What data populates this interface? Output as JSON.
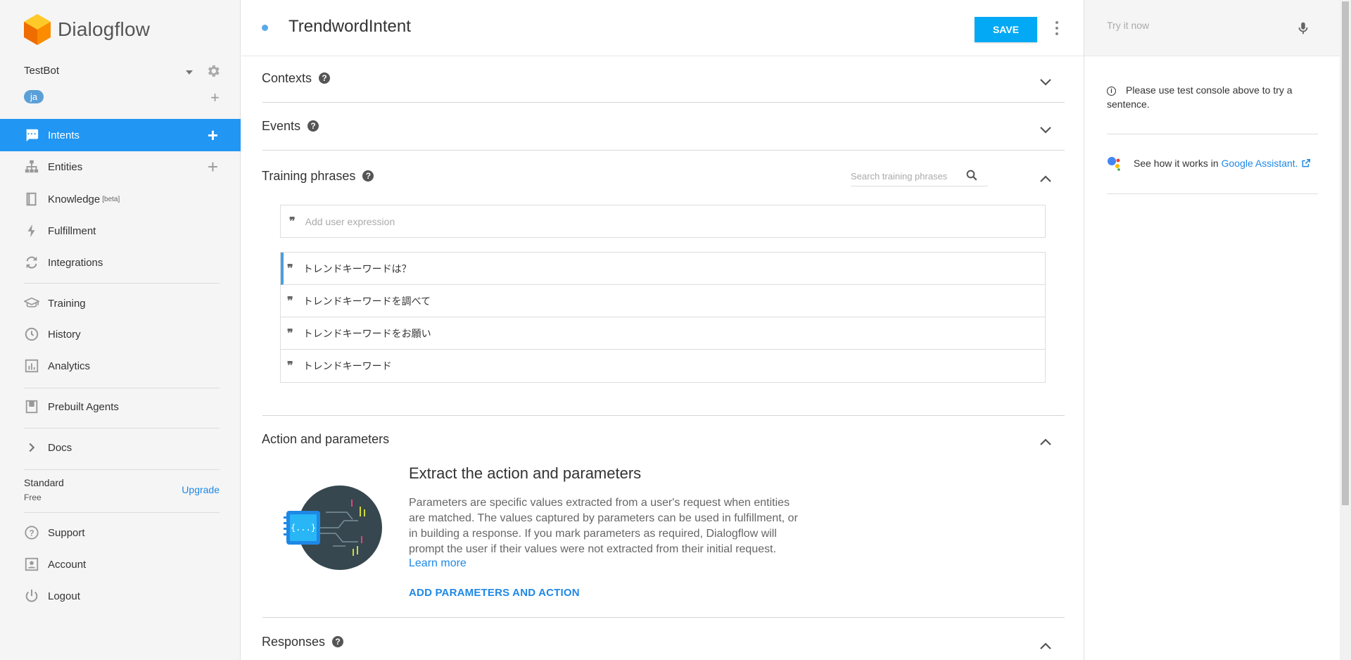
{
  "app": {
    "name": "Dialogflow"
  },
  "agent": {
    "name": "TestBot",
    "language": "ja"
  },
  "nav": {
    "intents": "Intents",
    "entities": "Entities",
    "knowledge": "Knowledge",
    "knowledge_tag": "[beta]",
    "fulfillment": "Fulfillment",
    "integrations": "Integrations",
    "training": "Training",
    "history": "History",
    "analytics": "Analytics",
    "prebuilt": "Prebuilt Agents",
    "docs": "Docs",
    "support": "Support",
    "account": "Account",
    "logout": "Logout"
  },
  "plan": {
    "name": "Standard",
    "tier": "Free",
    "upgrade": "Upgrade"
  },
  "intent": {
    "title": "TrendwordIntent",
    "save": "SAVE"
  },
  "sections": {
    "contexts": "Contexts",
    "events": "Events",
    "training_phrases": "Training phrases",
    "action_params": "Action and parameters",
    "responses": "Responses"
  },
  "training": {
    "search_placeholder": "Search training phrases",
    "add_placeholder": "Add user expression",
    "phrases": [
      "トレンドキーワードは？",
      "トレンドキーワードを調べて",
      "トレンドキーワードをお願い",
      "トレンドキーワード"
    ]
  },
  "action": {
    "heading": "Extract the action and parameters",
    "body": "Parameters are specific values extracted from a user's request when entities are matched. The values captured by parameters can be used in fulfillment, or in building a response. If you mark parameters as required, Dialogflow will prompt the user if their values were not extracted from their initial request.",
    "learn_more": "Learn more",
    "add_button": "ADD PARAMETERS AND ACTION"
  },
  "console": {
    "placeholder": "Try it now",
    "info": "Please use test console above to try a sentence.",
    "ga_text": "See how it works in",
    "ga_link": "Google Assistant."
  },
  "colors": {
    "accent": "#2196f3",
    "save": "#03a9f4",
    "link": "#1e88e5",
    "logo": "#f5a623"
  },
  "icons": [
    "dialogflow-logo-icon",
    "gear-icon",
    "chat-icon",
    "entities-icon",
    "book-icon",
    "bolt-icon",
    "sync-icon",
    "graduation-cap-icon",
    "clock-icon",
    "chart-icon",
    "prebuilt-icon",
    "chevron-right-icon",
    "help-circle-icon",
    "person-icon",
    "power-icon",
    "search-icon",
    "mic-icon",
    "quote-icon",
    "chevron-down-icon",
    "chevron-up-icon",
    "info-icon",
    "google-assistant-icon",
    "external-link-icon"
  ]
}
